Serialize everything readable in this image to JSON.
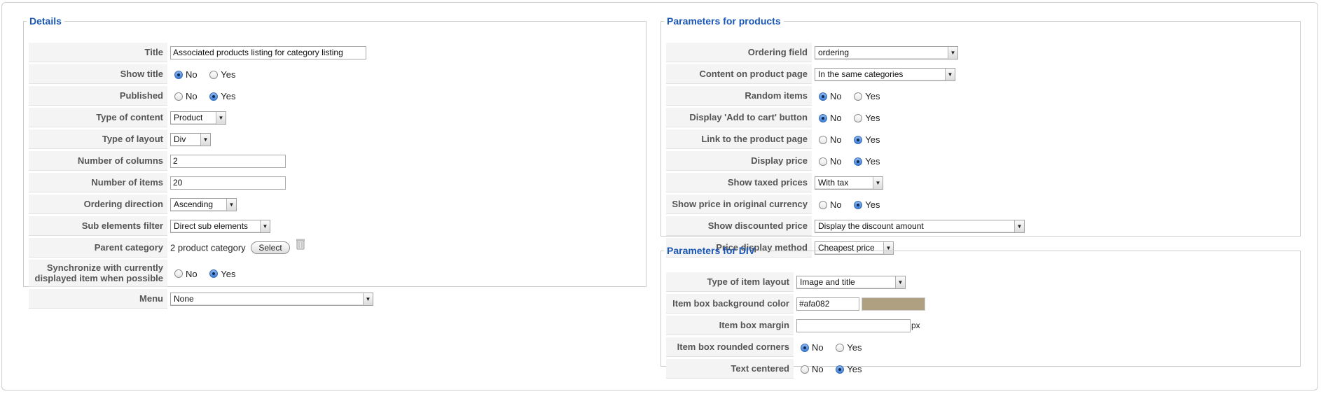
{
  "details": {
    "legend": "Details",
    "title_label": "Title",
    "title_value": "Associated products listing for category listing",
    "show_title_label": "Show title",
    "published_label": "Published",
    "type_content_label": "Type of content",
    "type_content_value": "Product",
    "type_layout_label": "Type of layout",
    "type_layout_value": "Div",
    "num_columns_label": "Number of columns",
    "num_columns_value": "2",
    "num_items_label": "Number of items",
    "num_items_value": "20",
    "ordering_dir_label": "Ordering direction",
    "ordering_dir_value": "Ascending",
    "sub_filter_label": "Sub elements filter",
    "sub_filter_value": "Direct sub elements",
    "parent_cat_label": "Parent category",
    "parent_cat_value": "2 product category",
    "select_button": "Select",
    "sync_label_1": "Synchronize with currently",
    "sync_label_2": "displayed item when possible",
    "menu_label": "Menu",
    "menu_value": "None"
  },
  "options": {
    "no": "No",
    "yes": "Yes"
  },
  "products": {
    "legend": "Parameters for products",
    "ordering_field_label": "Ordering field",
    "ordering_field_value": "ordering",
    "content_page_label": "Content on product page",
    "content_page_value": "In the same categories",
    "random_label": "Random items",
    "add_cart_label": "Display 'Add to cart' button",
    "link_label": "Link to the product page",
    "display_price_label": "Display price",
    "taxed_label": "Show taxed prices",
    "taxed_value": "With tax",
    "orig_currency_label": "Show price in original currency",
    "discounted_label": "Show discounted price",
    "discounted_value": "Display the discount amount",
    "price_method_label": "Price display method",
    "price_method_value": "Cheapest price"
  },
  "div": {
    "legend": "Parameters for DIV",
    "item_layout_label": "Type of item layout",
    "item_layout_value": "Image and title",
    "bg_color_label": "Item box background color",
    "bg_color_value": "#afa082",
    "margin_label": "Item box margin",
    "margin_value": "",
    "margin_unit": "px",
    "rounded_label": "Item box rounded corners",
    "centered_label": "Text centered"
  },
  "colors": {
    "legend": "#1a57b5",
    "swatch": "#afa082"
  }
}
